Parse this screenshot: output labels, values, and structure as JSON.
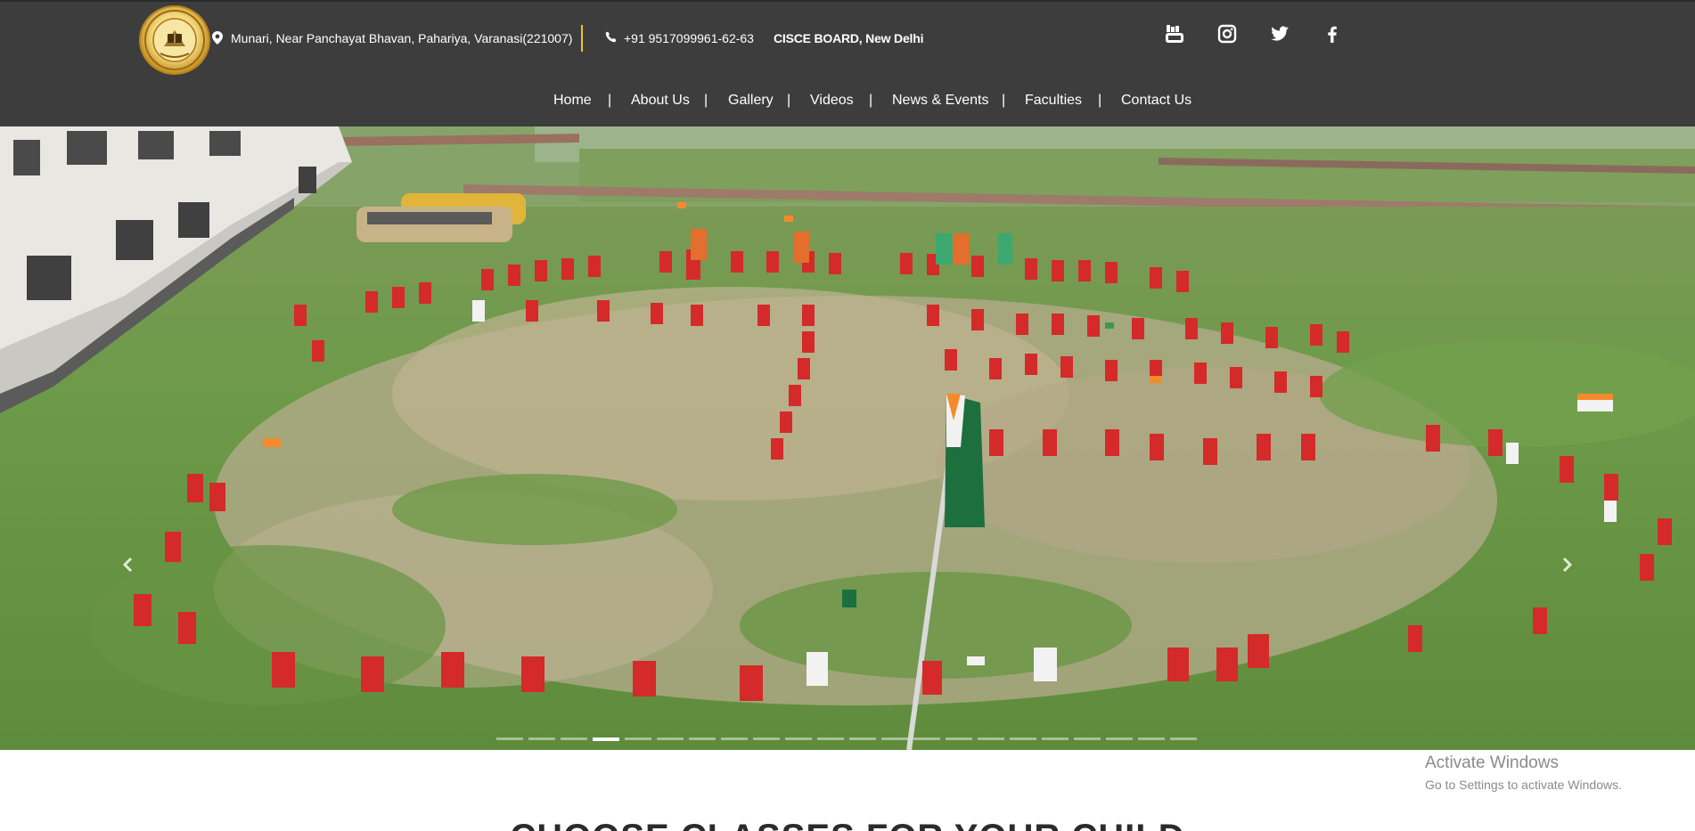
{
  "header": {
    "address": "Munari, Near Panchayat Bhavan, Pahariya, Varanasi(221007)",
    "phone": "+91 9517099961-62-63",
    "board": "CISCE BOARD, New Delhi",
    "accent_color": "#f3c512",
    "background_color": "#3d3d3d",
    "logo_icon": "school-crest-logo",
    "address_icon": "map-marker-icon",
    "phone_icon": "phone-icon"
  },
  "social": [
    {
      "name": "YouTube",
      "icon": "youtube-icon"
    },
    {
      "name": "Instagram",
      "icon": "instagram-icon"
    },
    {
      "name": "Twitter",
      "icon": "twitter-icon"
    },
    {
      "name": "Facebook",
      "icon": "facebook-icon"
    }
  ],
  "nav": {
    "items": [
      "Home",
      "About Us",
      "Gallery",
      "Videos",
      "News & Events",
      "Faculties",
      "Contact Us"
    ],
    "separator": "|"
  },
  "slider": {
    "slide_count": 22,
    "active_index": 3,
    "prev_icon": "chevron-left-icon",
    "next_icon": "chevron-right-icon"
  },
  "section": {
    "title": "CHOOSE CLASSES FOR YOUR CHILD"
  },
  "watermark": {
    "title": "Activate Windows",
    "subtitle": "Go to Settings to activate Windows."
  }
}
